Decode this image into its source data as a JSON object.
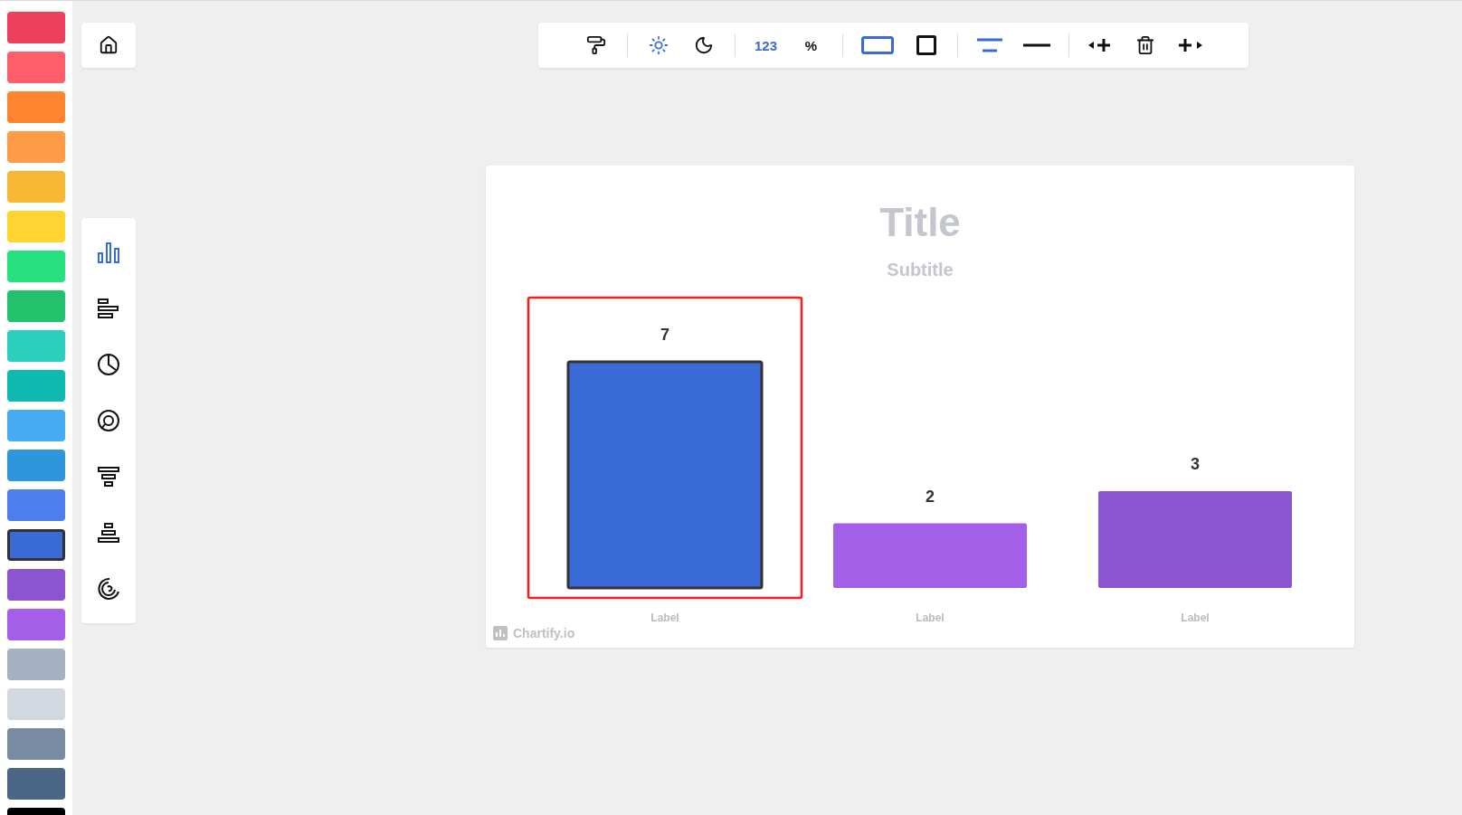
{
  "palette": [
    {
      "color": "#ee3f5c",
      "selected": false
    },
    {
      "color": "#fd5e69",
      "selected": false
    },
    {
      "color": "#fe8430",
      "selected": false
    },
    {
      "color": "#fe9b47",
      "selected": false
    },
    {
      "color": "#f8b635",
      "selected": false
    },
    {
      "color": "#ffd430",
      "selected": false
    },
    {
      "color": "#27e07f",
      "selected": false
    },
    {
      "color": "#22c16b",
      "selected": false
    },
    {
      "color": "#2bcfbd",
      "selected": false
    },
    {
      "color": "#0fbab1",
      "selected": false
    },
    {
      "color": "#46abf2",
      "selected": false
    },
    {
      "color": "#2e97dc",
      "selected": false
    },
    {
      "color": "#4e7ded",
      "selected": false
    },
    {
      "color": "#3a6ad6",
      "selected": true
    },
    {
      "color": "#8a55cf",
      "selected": false
    },
    {
      "color": "#a35fe8",
      "selected": false
    },
    {
      "color": "#a5b1c2",
      "selected": false
    },
    {
      "color": "#d1d8e0",
      "selected": false
    },
    {
      "color": "#778ca3",
      "selected": false
    },
    {
      "color": "#4b6584",
      "selected": false
    },
    {
      "color": "#000000",
      "selected": false
    }
  ],
  "toolbar": [
    [
      {
        "kind": "roller",
        "selected": false
      }
    ],
    [
      {
        "kind": "sun",
        "selected": true
      },
      {
        "kind": "moon",
        "selected": false
      }
    ],
    [
      {
        "kind": "text",
        "label": "123",
        "selected": true
      },
      {
        "kind": "text",
        "label": "%",
        "selected": false
      }
    ],
    [
      {
        "kind": "wide",
        "selected": true
      },
      {
        "kind": "square",
        "selected": false
      }
    ],
    [
      {
        "kind": "double-line",
        "selected": true
      },
      {
        "kind": "line",
        "selected": false
      }
    ],
    [
      {
        "kind": "add-left",
        "selected": false
      },
      {
        "kind": "trash",
        "selected": false
      },
      {
        "kind": "add-right",
        "selected": false
      }
    ]
  ],
  "chart_types": [
    {
      "kind": "column",
      "selected": true
    },
    {
      "kind": "bar",
      "selected": false
    },
    {
      "kind": "pie",
      "selected": false
    },
    {
      "kind": "donut",
      "selected": false
    },
    {
      "kind": "funnel",
      "selected": false
    },
    {
      "kind": "pyramid",
      "selected": false
    },
    {
      "kind": "spiral",
      "selected": false
    }
  ],
  "chart": {
    "subtitle": "Subtitle",
    "watermark": "Chartify.io",
    "bars": [
      {
        "color": "#3a6ad6",
        "selected": true
      },
      {
        "color": "#a35fe8",
        "selected": false
      },
      {
        "color": "#8a55cf",
        "selected": false
      }
    ],
    "chart_data": {
      "type": "bar",
      "title": "Title",
      "categories": [
        "Label",
        "Label",
        "Label"
      ],
      "series": [
        {
          "values": [
            7,
            2,
            3
          ]
        }
      ],
      "data_labels": true
    }
  }
}
